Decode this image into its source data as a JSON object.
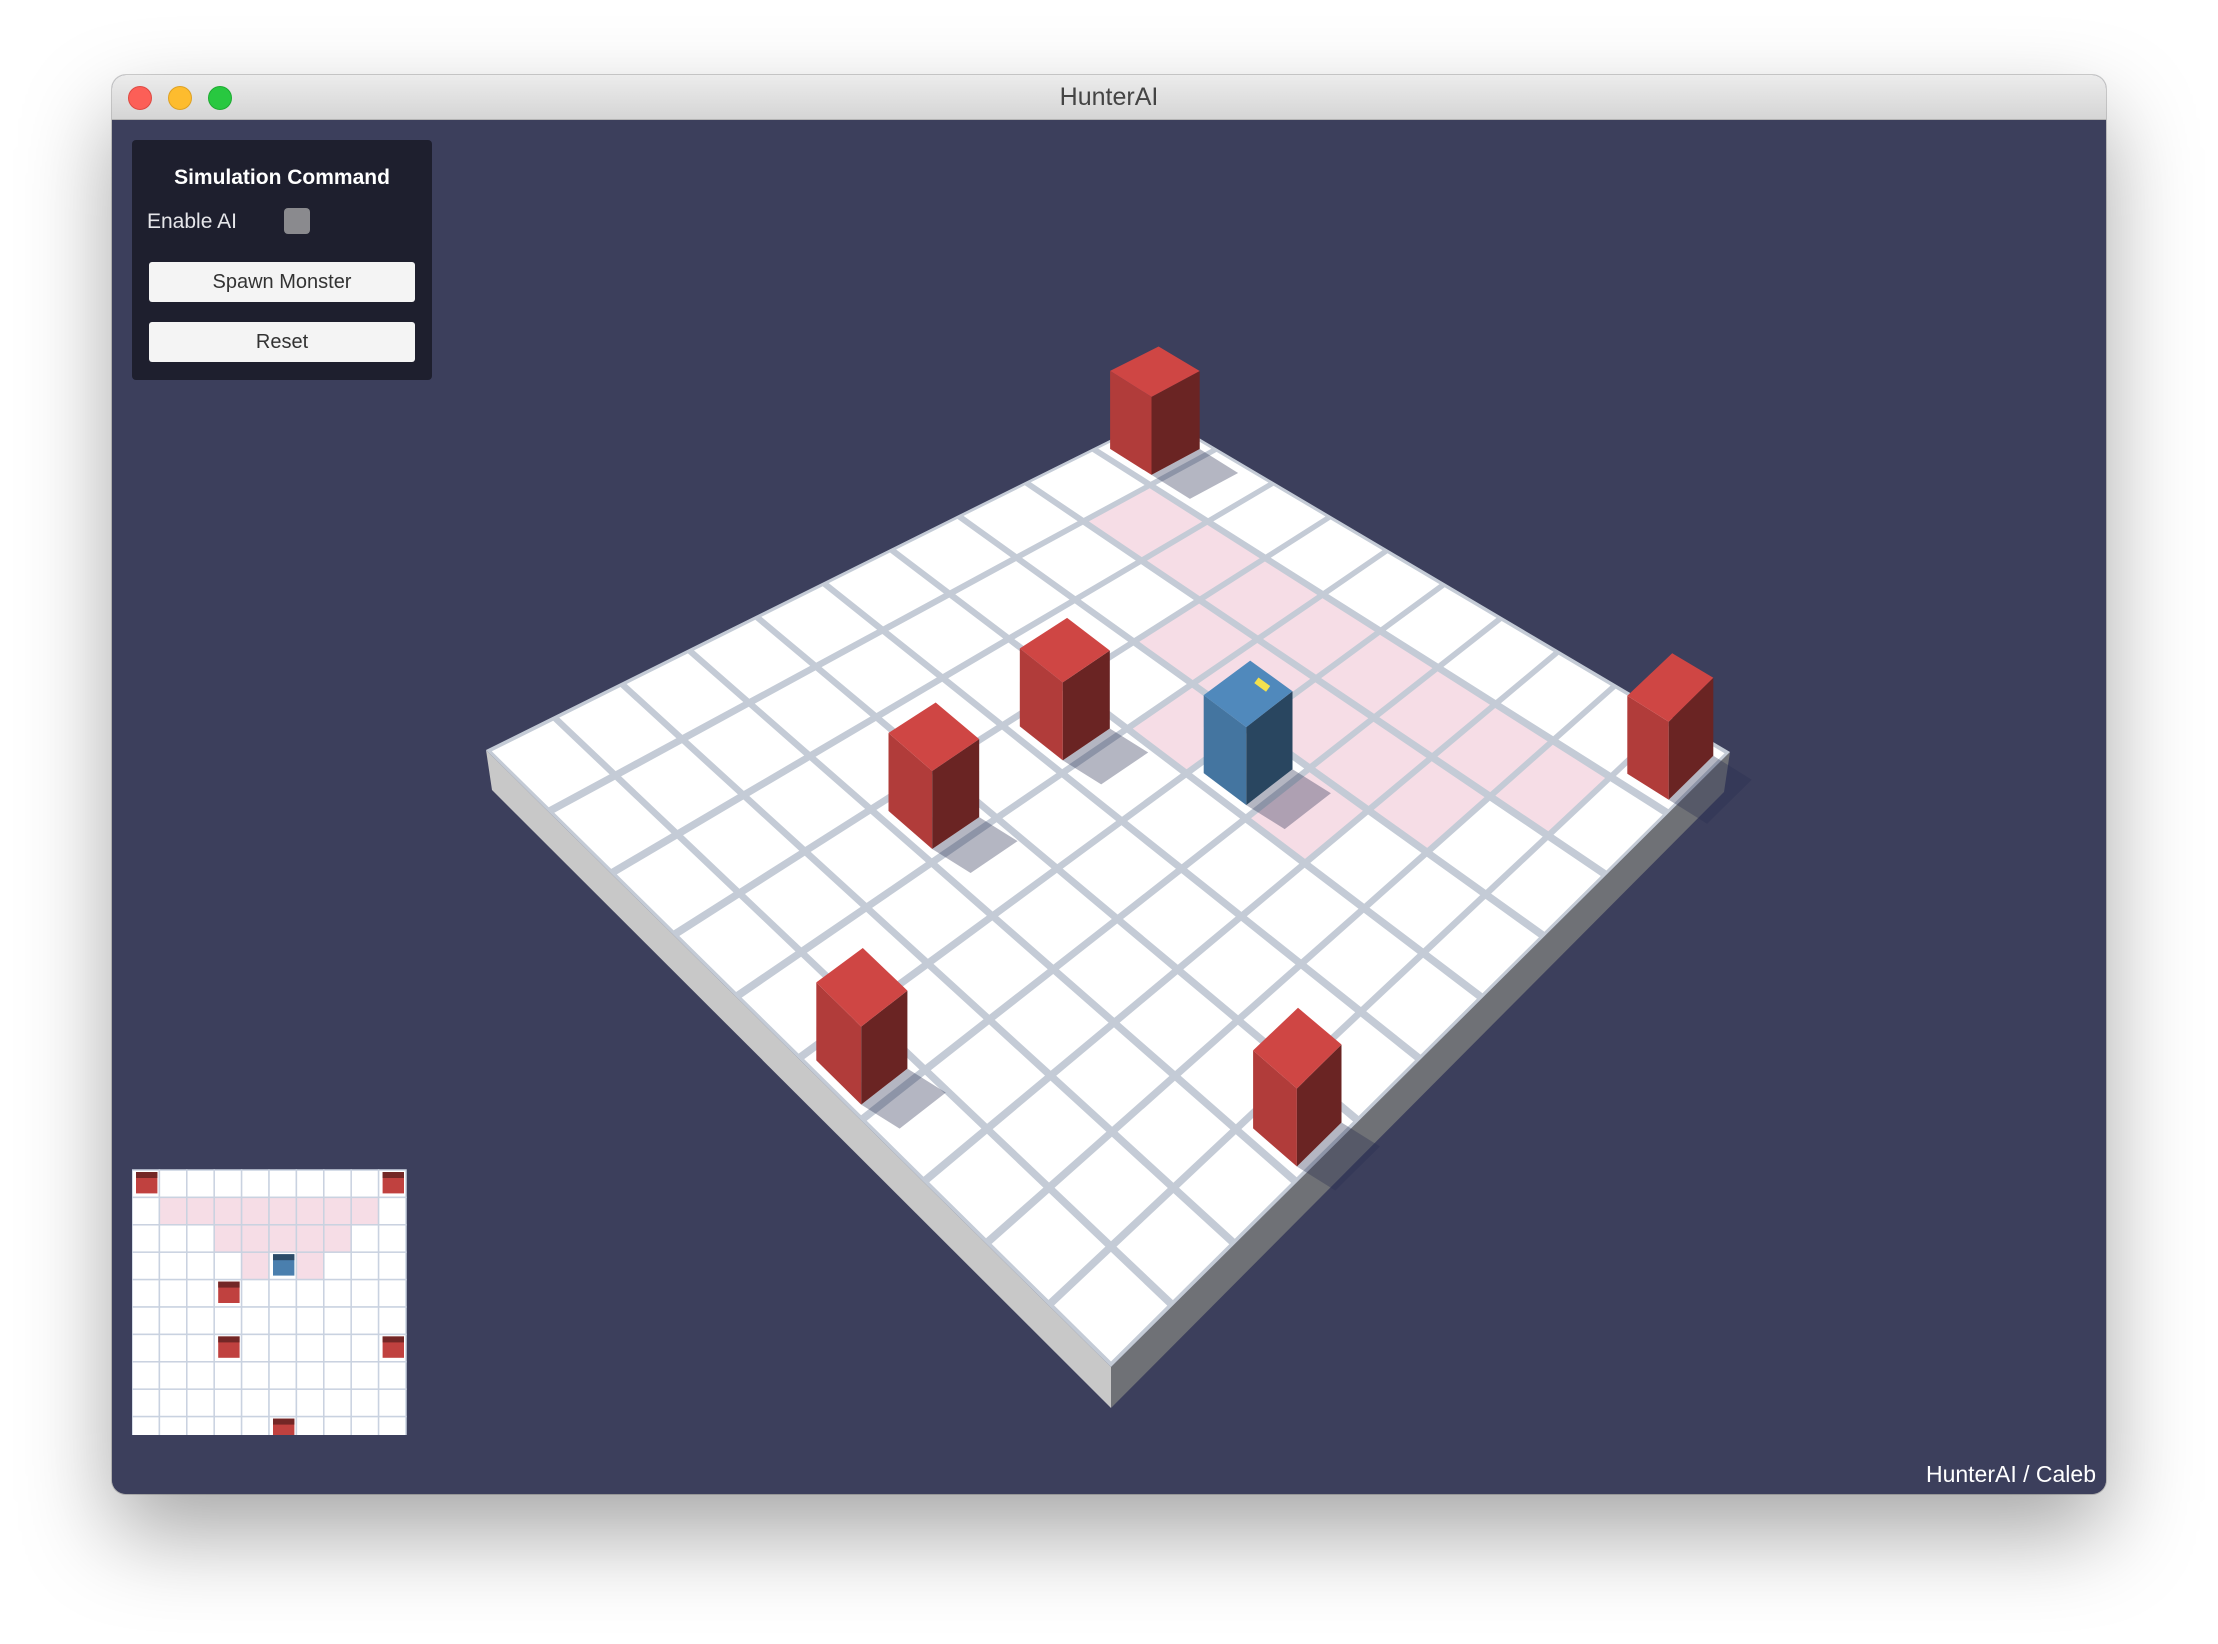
{
  "window": {
    "title": "HunterAI"
  },
  "panel": {
    "title": "Simulation Command",
    "enable_ai_label": "Enable AI",
    "enable_ai_checked": false,
    "spawn_button": "Spawn Monster",
    "reset_button": "Reset"
  },
  "footer": {
    "credit": "HunterAI / Caleb"
  },
  "colors": {
    "background": "#3c3f5c",
    "panel": "#1e1f2e",
    "tile": "#ffffff",
    "grid_line": "#c4cbd6",
    "highlight": "#f6dde6",
    "monster": "#c0413f",
    "hunter": "#4a7fae",
    "hunter_marker": "#f4e04d"
  },
  "icons": {
    "close": "traffic-light-close-icon",
    "minimize": "traffic-light-minimize-icon",
    "maximize": "traffic-light-maximize-icon"
  },
  "board": {
    "size": 10,
    "monsters": [
      [
        0,
        0
      ],
      [
        0,
        9
      ],
      [
        6,
        9
      ],
      [
        4,
        3
      ],
      [
        6,
        3
      ],
      [
        9,
        5
      ]
    ],
    "hunter": [
      3,
      5
    ],
    "highlighted": [
      [
        1,
        1
      ],
      [
        1,
        2
      ],
      [
        1,
        3
      ],
      [
        1,
        4
      ],
      [
        1,
        5
      ],
      [
        1,
        6
      ],
      [
        1,
        7
      ],
      [
        1,
        8
      ],
      [
        2,
        3
      ],
      [
        2,
        4
      ],
      [
        2,
        5
      ],
      [
        2,
        6
      ],
      [
        2,
        7
      ],
      [
        3,
        4
      ],
      [
        3,
        6
      ]
    ]
  }
}
